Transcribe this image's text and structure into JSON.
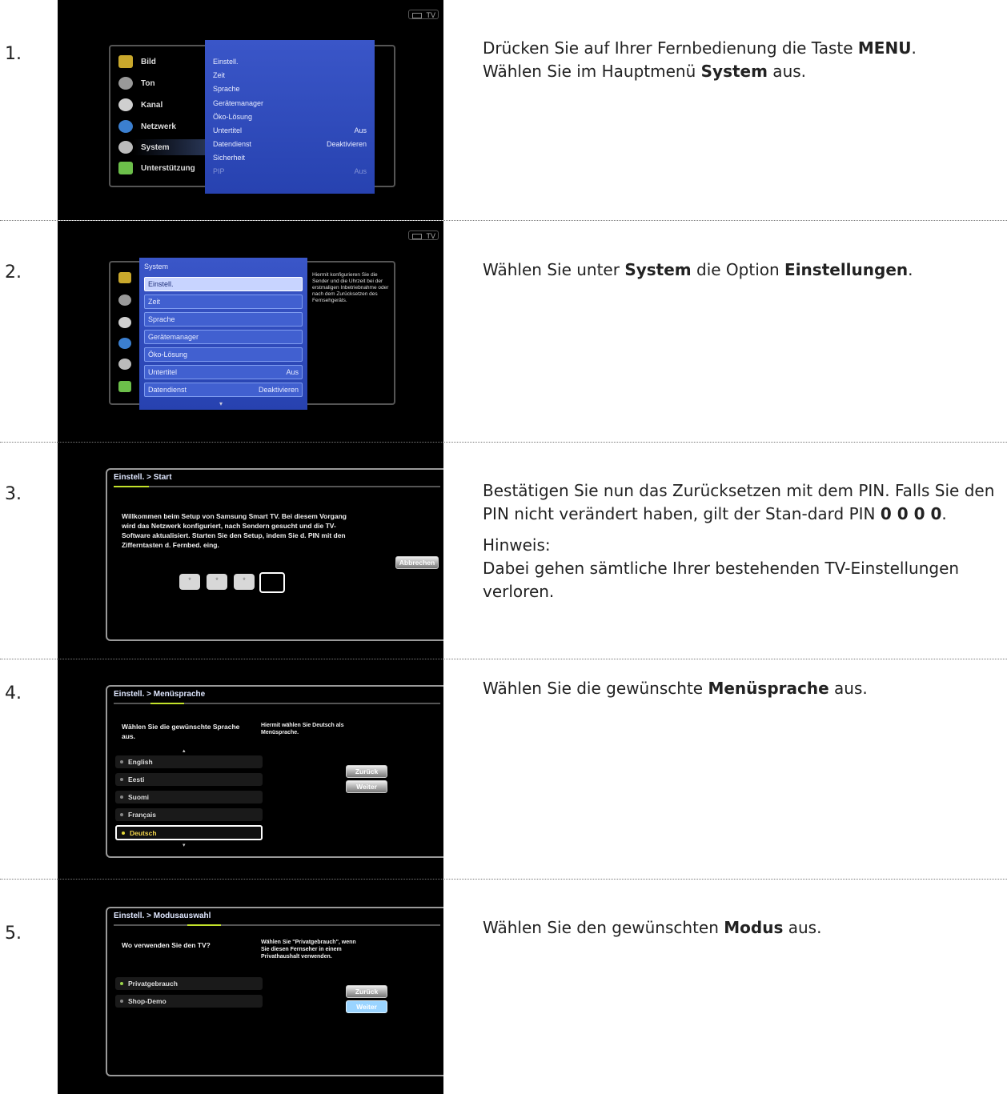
{
  "tv_badge": "TV",
  "steps": [
    {
      "num": "1.",
      "desc": [
        {
          "pre": "Drücken Sie auf Ihrer Fernbedienung die Taste ",
          "b": "MENU",
          "post": "."
        },
        {
          "pre": "Wählen Sie im Hauptmenü ",
          "b": "System",
          "post": " aus."
        }
      ],
      "screen": {
        "main_menu": [
          "Bild",
          "Ton",
          "Kanal",
          "Netzwerk",
          "System",
          "Unterstützung"
        ],
        "submenu": [
          {
            "label": "Einstell.",
            "value": ""
          },
          {
            "label": "Zeit",
            "value": ""
          },
          {
            "label": "Sprache",
            "value": ""
          },
          {
            "label": "Gerätemanager",
            "value": ""
          },
          {
            "label": "Öko-Lösung",
            "value": ""
          },
          {
            "label": "Untertitel",
            "value": "Aus"
          },
          {
            "label": "Datendienst",
            "value": "Deaktivieren"
          },
          {
            "label": "Sicherheit",
            "value": ""
          },
          {
            "label": "PIP",
            "value": "Aus"
          }
        ]
      }
    },
    {
      "num": "2.",
      "desc": [
        {
          "pre": "Wählen Sie unter ",
          "b": "System",
          "post": " die Option ",
          "b2": "Einstellungen",
          "post2": "."
        }
      ],
      "screen": {
        "title": "System",
        "items": [
          {
            "label": "Einstell.",
            "value": ""
          },
          {
            "label": "Zeit",
            "value": ""
          },
          {
            "label": "Sprache",
            "value": ""
          },
          {
            "label": "Gerätemanager",
            "value": ""
          },
          {
            "label": "Öko-Lösung",
            "value": ""
          },
          {
            "label": "Untertitel",
            "value": "Aus"
          },
          {
            "label": "Datendienst",
            "value": "Deaktivieren"
          }
        ],
        "help": "Hiermit konfigurieren Sie die Sender und die Uhrzeit bei der erstmaligen Inbetriebnahme oder nach dem Zurücksetzen des Fernsehgeräts."
      }
    },
    {
      "num": "3.",
      "desc_p1": "Bestätigen Sie nun das Zurücksetzen mit dem PIN. Falls Sie den PIN nicht verändert haben, gilt der Stan-dard PIN ",
      "desc_pin": "0 0 0 0",
      "desc_p1_end": ".",
      "hint_label": "Hinweis:",
      "hint_text": "Dabei gehen sämtliche Ihrer bestehenden TV-Einstellungen verloren.",
      "screen": {
        "title": "Einstell. > Start",
        "text": "Willkommen beim Setup von Samsung Smart TV. Bei diesem Vorgang wird das Netzwerk konfiguriert, nach Sendern gesucht und die TV-Software aktualisiert. Starten Sie den Setup, indem Sie d. PIN mit den Zifferntasten d. Fernbed. eing.",
        "cancel": "Abbrechen"
      }
    },
    {
      "num": "4.",
      "desc": [
        {
          "pre": "Wählen Sie die gewünschte ",
          "b": "Menüsprache",
          "post": " aus."
        }
      ],
      "screen": {
        "title": "Einstell. > Menüsprache",
        "question": "Wählen Sie die gewünschte Sprache aus.",
        "help": "Hiermit wählen Sie Deutsch als Menüsprache.",
        "options": [
          "English",
          "Eesti",
          "Suomi",
          "Français",
          "Deutsch"
        ],
        "back": "Zurück",
        "next": "Weiter"
      }
    },
    {
      "num": "5.",
      "desc": [
        {
          "pre": "Wählen Sie den gewünschten ",
          "b": "Modus",
          "post": " aus."
        }
      ],
      "screen": {
        "title": "Einstell. > Modusauswahl",
        "question": "Wo verwenden Sie den TV?",
        "help": "Wählen Sie \"Privatgebrauch\", wenn Sie diesen Fernseher in einem Privathaushalt verwenden.",
        "options": [
          "Privatgebrauch",
          "Shop-Demo"
        ],
        "back": "Zurück",
        "next": "Weiter"
      }
    }
  ]
}
